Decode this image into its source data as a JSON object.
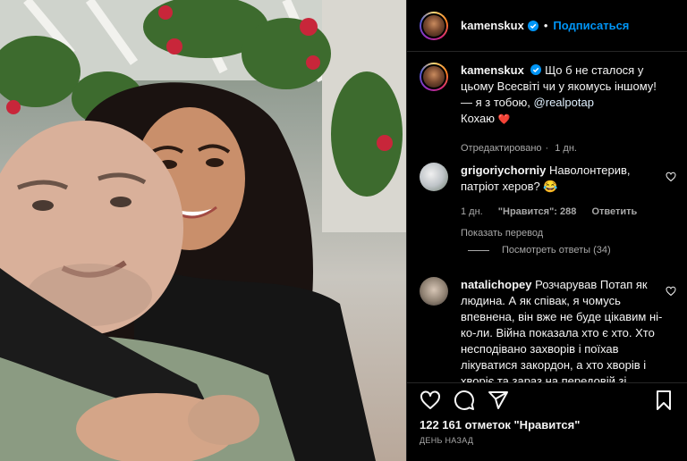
{
  "post_author": {
    "username": "kamenskux",
    "follow_label": "Подписаться",
    "separator": "•"
  },
  "caption": {
    "username": "kamenskux",
    "text": "Що б не сталося у цьому Всесвіті чи у якомусь іншому! — я з тобою,",
    "mention": "@realpotap",
    "text2": "Кохаю",
    "heart": "❤️",
    "edited": "Отредактировано",
    "time": "1 дн."
  },
  "comments": [
    {
      "username": "grigoriychorniy",
      "text": "Наволонтерив, патріот херов? 😂",
      "time": "1 дн.",
      "likes": "\"Нравится\": 288",
      "reply_label": "Ответить",
      "translate_label": "Показать перевод",
      "replies_label": "Посмотреть ответы (34)"
    },
    {
      "username": "natalichopey",
      "text": "Розчарував Потап як людина. А як співак, я чомусь впевнена, він вже не буде цікавим ні- ко-ли. Війна показала хто є хто. Хто несподівано захворів і поїхав лікуватися закордон, а хто хворів і хворіє та зараз на передовій зі"
    }
  ],
  "footer": {
    "likes": "122 161 отметок \"Нравится\"",
    "date": "ДЕНЬ НАЗАД"
  },
  "icons": {
    "verified": "verified-badge-icon",
    "like": "heart-icon",
    "comment": "comment-icon",
    "share": "send-icon",
    "save": "bookmark-icon"
  },
  "colors": {
    "background": "#000000",
    "accent": "#0095f6",
    "secondary_text": "#a8a8a8",
    "heart": "#ed4956"
  }
}
